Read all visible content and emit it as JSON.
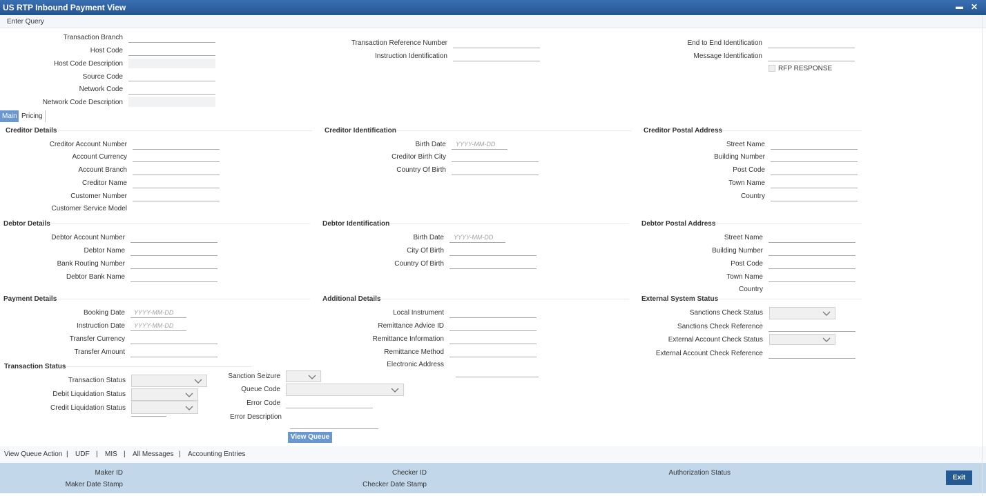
{
  "window": {
    "title": "US RTP Inbound Payment View",
    "minimize": "▬",
    "close": "✕"
  },
  "menu": {
    "enter_query": "Enter Query"
  },
  "header": {
    "transaction_branch": "Transaction Branch",
    "host_code": "Host Code",
    "host_code_description": "Host Code Description",
    "source_code": "Source Code",
    "network_code": "Network Code",
    "network_code_description": "Network Code Description",
    "transaction_reference_number": "Transaction Reference Number",
    "instruction_identification": "Instruction Identification",
    "end_to_end_identification": "End to End Identification",
    "message_identification": "Message Identification",
    "rfp_response": "RFP RESPONSE"
  },
  "tabs": {
    "main": "Main",
    "pricing": "Pricing"
  },
  "date_placeholder": "YYYY-MM-DD",
  "creditor_details": {
    "title": "Creditor Details",
    "account_number": "Creditor Account Number",
    "account_currency": "Account Currency",
    "account_branch": "Account Branch",
    "creditor_name": "Creditor Name",
    "customer_number": "Customer Number",
    "customer_service_model": "Customer Service Model"
  },
  "creditor_identification": {
    "title": "Creditor Identification",
    "birth_date": "Birth Date",
    "birth_city": "Creditor Birth City",
    "country_of_birth": "Country Of Birth"
  },
  "creditor_postal": {
    "title": "Creditor Postal Address",
    "street_name": "Street Name",
    "building_number": "Building Number",
    "post_code": "Post Code",
    "town_name": "Town Name",
    "country": "Country"
  },
  "debtor_details": {
    "title": "Debtor Details",
    "account_number": "Debtor Account Number",
    "debtor_name": "Debtor Name",
    "bank_routing_number": "Bank Routing Number",
    "bank_name": "Debtor Bank Name"
  },
  "debtor_identification": {
    "title": "Debtor Identification",
    "birth_date": "Birth Date",
    "city_of_birth": "City Of Birth",
    "country_of_birth": "Country Of Birth"
  },
  "debtor_postal": {
    "title": "Debtor Postal Address",
    "street_name": "Street Name",
    "building_number": "Building Number",
    "post_code": "Post Code",
    "town_name": "Town Name",
    "country": "Country"
  },
  "payment_details": {
    "title": "Payment Details",
    "booking_date": "Booking Date",
    "instruction_date": "Instruction Date",
    "transfer_currency": "Transfer Currency",
    "transfer_amount": "Transfer Amount"
  },
  "additional_details": {
    "title": "Additional Details",
    "local_instrument": "Local Instrument",
    "remittance_advice_id": "Remittance Advice ID",
    "remittance_information": "Remittance Information",
    "remittance_method": "Remittance Method",
    "electronic_address": "Electronic Address"
  },
  "external_status": {
    "title": "External System Status",
    "sanctions_check_status": "Sanctions Check Status",
    "sanctions_check_reference": "Sanctions Check Reference",
    "external_account_check_status": "External Account Check Status",
    "external_account_check_reference": "External Account Check Reference"
  },
  "transaction_status": {
    "title": "Transaction Status",
    "transaction_status": "Transaction Status",
    "debit_liquidation_status": "Debit Liquidation Status",
    "credit_liquidation_status": "Credit Liquidation Status",
    "sanction_seizure": "Sanction Seizure",
    "queue_code": "Queue Code",
    "error_code": "Error Code",
    "error_description": "Error Description",
    "view_queue": "View Queue"
  },
  "links": {
    "view_queue_action": "View Queue Action",
    "udf": "UDF",
    "mis": "MIS",
    "all_messages": "All Messages",
    "accounting_entries": "Accounting Entries",
    "separator": "|"
  },
  "footer": {
    "maker_id": "Maker ID",
    "maker_date_stamp": "Maker Date Stamp",
    "checker_id": "Checker ID",
    "checker_date_stamp": "Checker Date Stamp",
    "authorization_status": "Authorization Status",
    "exit": "Exit"
  },
  "colors": {
    "titlebar": "#24558f",
    "accent": "#6a97cf",
    "footer": "#c2d8ea",
    "exit": "#245a94"
  }
}
